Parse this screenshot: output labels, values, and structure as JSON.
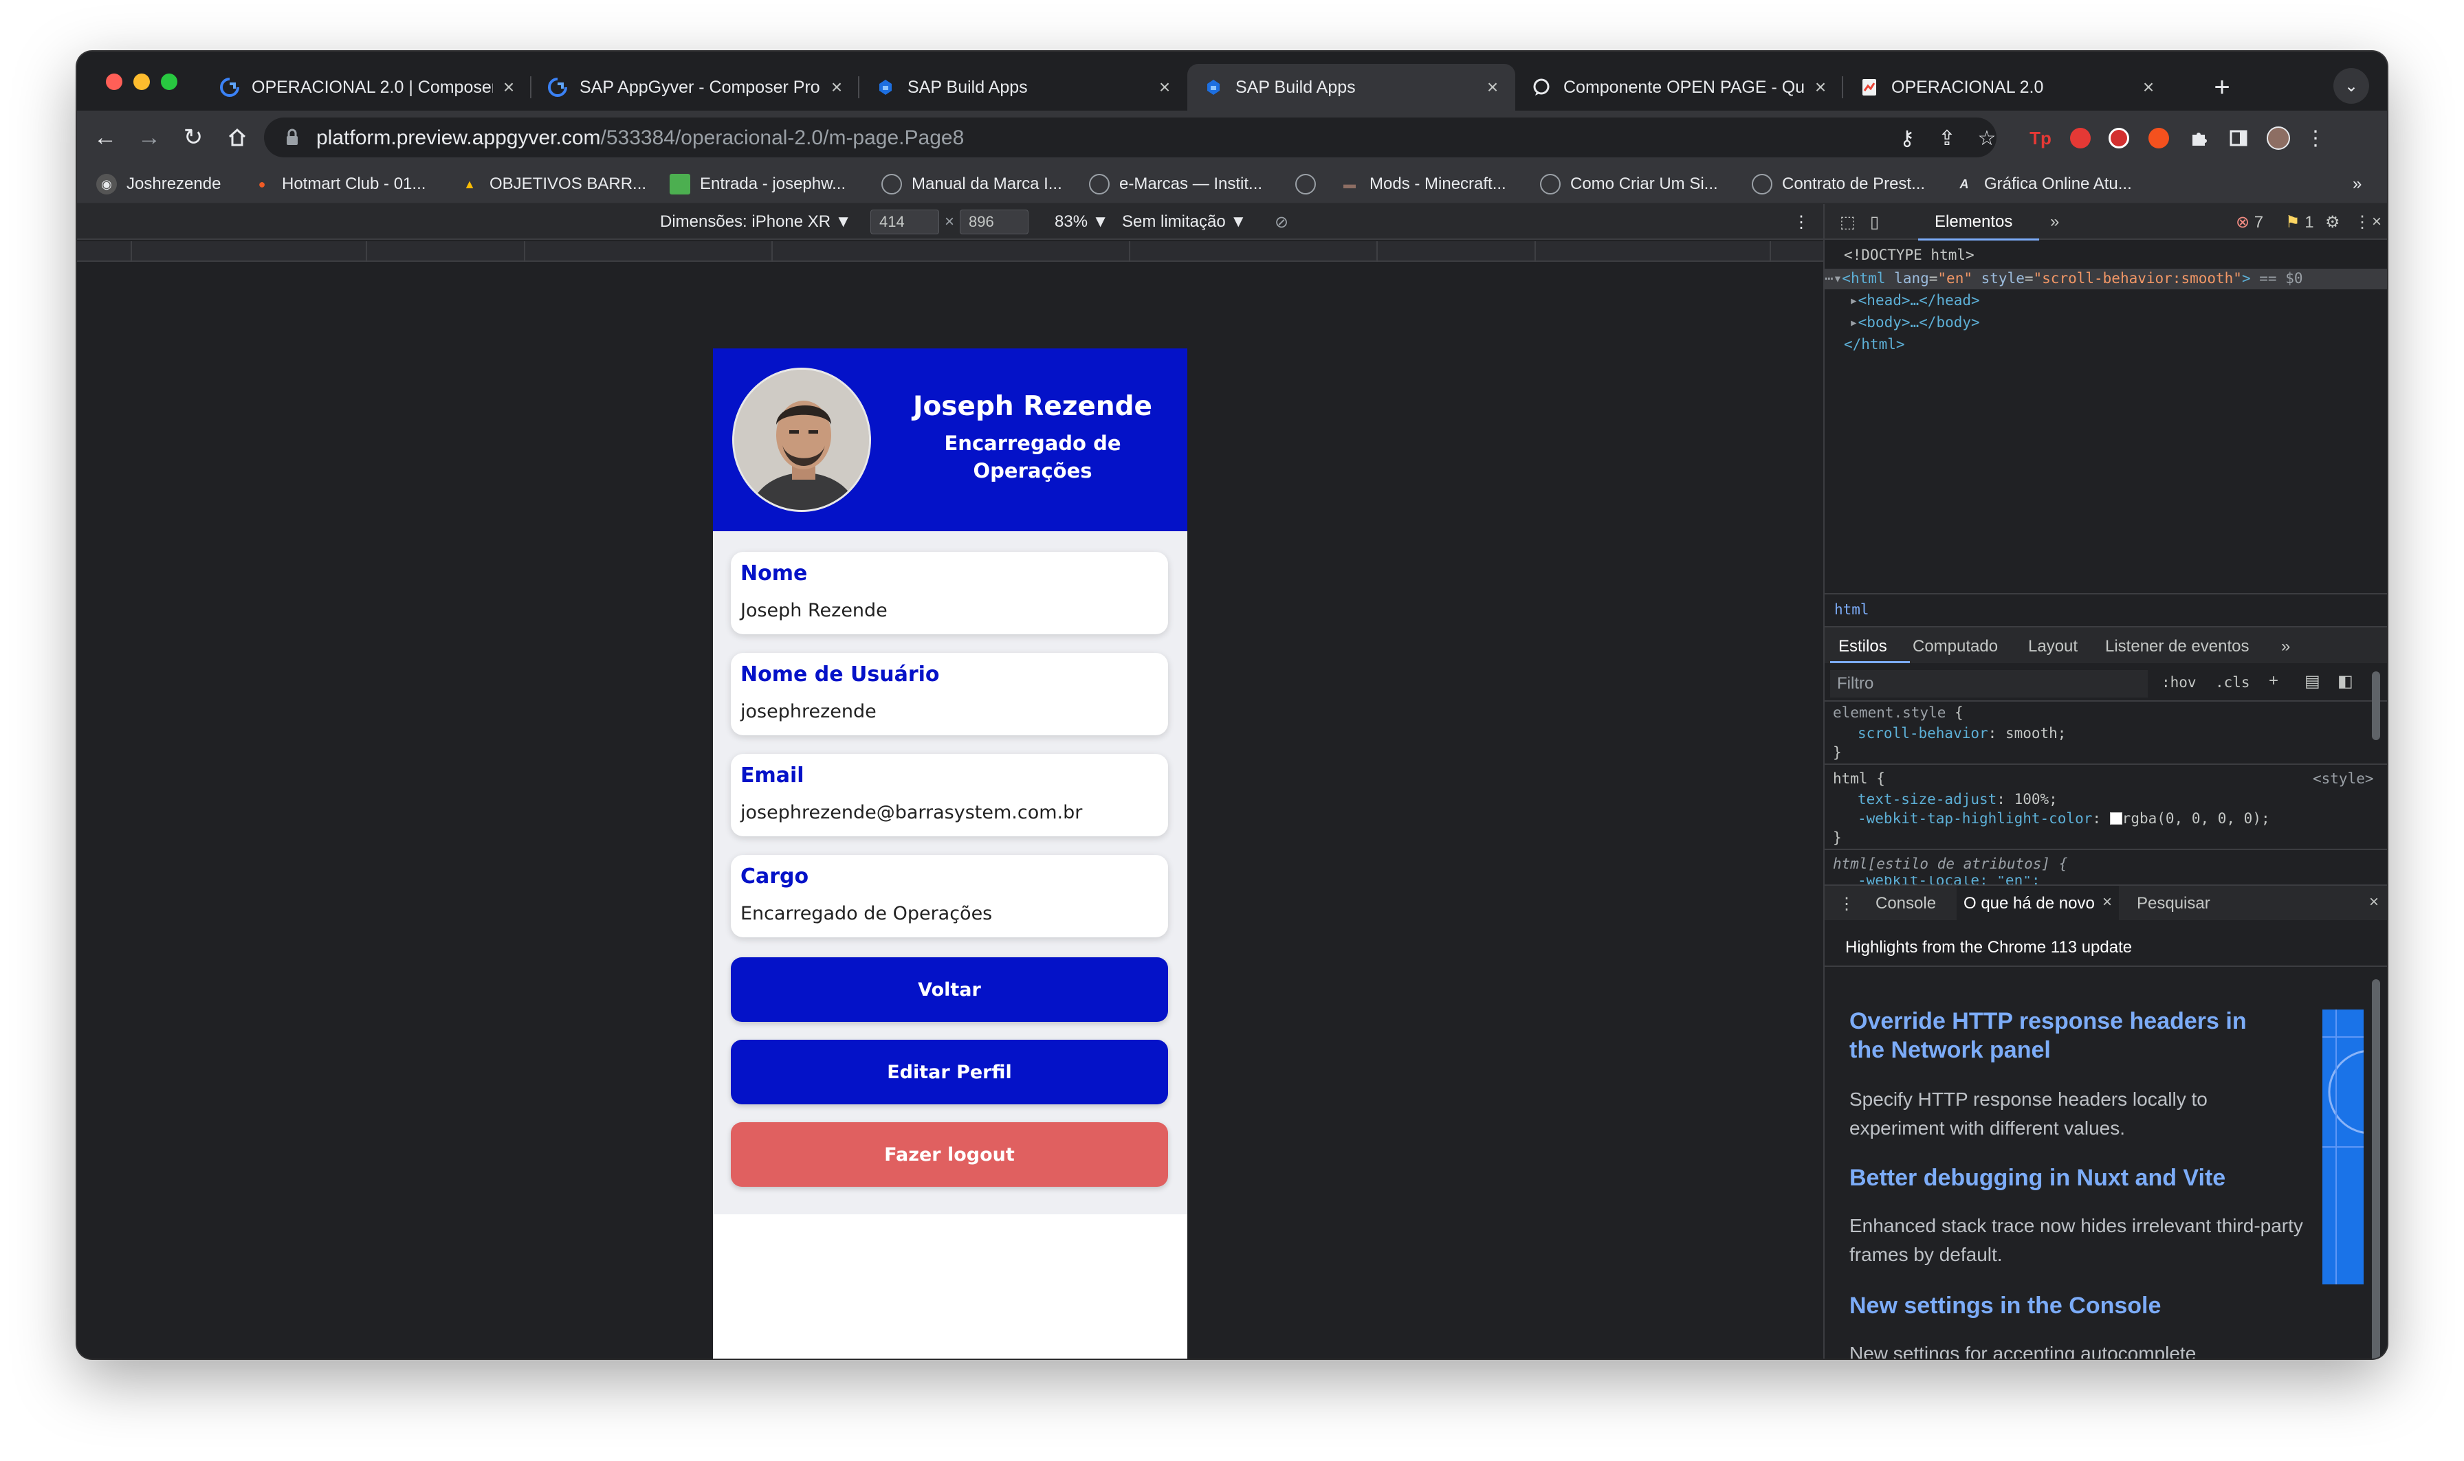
{
  "browser": {
    "tabs": [
      {
        "title": "OPERACIONAL 2.0 | Composer",
        "icon": "appgyver-icon",
        "active": false
      },
      {
        "title": "SAP AppGyver - Composer Pro",
        "icon": "appgyver-icon",
        "active": false
      },
      {
        "title": "SAP Build Apps",
        "icon": "sap-build-icon",
        "active": false
      },
      {
        "title": "SAP Build Apps",
        "icon": "sap-build-icon",
        "active": true
      },
      {
        "title": "Componente OPEN PAGE - Qu",
        "icon": "chat-icon",
        "active": false
      },
      {
        "title": "OPERACIONAL 2.0",
        "icon": "sheets-icon",
        "active": false
      }
    ],
    "new_tab": "+",
    "url_host": "platform.preview.appgyver.com",
    "url_path": "/533384/operacional-2.0/m-page.Page8",
    "bookmarks": [
      "Joshrezende",
      "Hotmart Club - 01...",
      "OBJETIVOS BARR...",
      "Entrada - josephw...",
      "Manual da Marca I...",
      "e-Marcas — Instit...",
      "",
      "Mods - Minecraft...",
      "Como Criar Um Si...",
      "Contrato de Prest...",
      "Gráfica Online Atu..."
    ],
    "bookmarks_more": "»"
  },
  "device_toolbar": {
    "dimensions_label": "Dimensões: iPhone XR ▼",
    "width": "414",
    "times": "×",
    "height": "896",
    "zoom": "83% ▼",
    "throttle": "Sem limitação ▼"
  },
  "app": {
    "profile": {
      "name": "Joseph Rezende",
      "role": "Encarregado de Operações"
    },
    "fields": [
      {
        "label": "Nome",
        "value": "Joseph Rezende"
      },
      {
        "label": "Nome de Usuário",
        "value": "josephrezende"
      },
      {
        "label": "Email",
        "value": "josephrezende@barrasystem.com.br"
      },
      {
        "label": "Cargo",
        "value": "Encarregado de Operações"
      }
    ],
    "buttons": {
      "back": "Voltar",
      "edit": "Editar Perfil",
      "logout": "Fazer logout"
    },
    "colors": {
      "primary": "#0412c8",
      "danger": "#e06060"
    }
  },
  "devtools": {
    "panel_tab": "Elementos",
    "more": "»",
    "errors": "7",
    "warnings": "1",
    "dom": {
      "doctype": "<!DOCTYPE html>",
      "html_open": "<html lang=\"en\" style=\"scroll-behavior:smooth\">",
      "html_suffix": "== $0",
      "head": "<head>…</head>",
      "body": "<body>…</body>",
      "html_close": "</html>"
    },
    "breadcrumb": "html",
    "styles_tabs": [
      "Estilos",
      "Computado",
      "Layout",
      "Listener de eventos"
    ],
    "filter_placeholder": "Filtro",
    "hov": ":hov",
    "cls": ".cls",
    "rules": {
      "element_style": "element.style {",
      "scroll_prop": "scroll-behavior",
      "scroll_val": "smooth;",
      "html_sel": "html {",
      "html_src": "<style>",
      "prop1": "text-size-adjust",
      "val1": "100%;",
      "prop2": "-webkit-tap-highlight-color",
      "val2": "rgba(0, 0, 0, 0);",
      "attr_rule": "html[estilo de atributos] {",
      "locale_line": "-webkit-locale: \"en\";",
      "close": "}"
    },
    "drawer_tabs": [
      "Console",
      "O que há de novo",
      "Pesquisar"
    ],
    "drawer_header": "Highlights from the Chrome 113 update",
    "whats_new": [
      {
        "title": "Override HTTP response headers in the Network panel",
        "desc": "Specify HTTP response headers locally to experiment with different values."
      },
      {
        "title": "Better debugging in Nuxt and Vite",
        "desc": "Enhanced stack trace now hides irrelevant third-party frames by default."
      },
      {
        "title": "New settings in the Console",
        "desc": "New settings for accepting autocomplete suggestions when pressing Enter, and more."
      }
    ]
  }
}
